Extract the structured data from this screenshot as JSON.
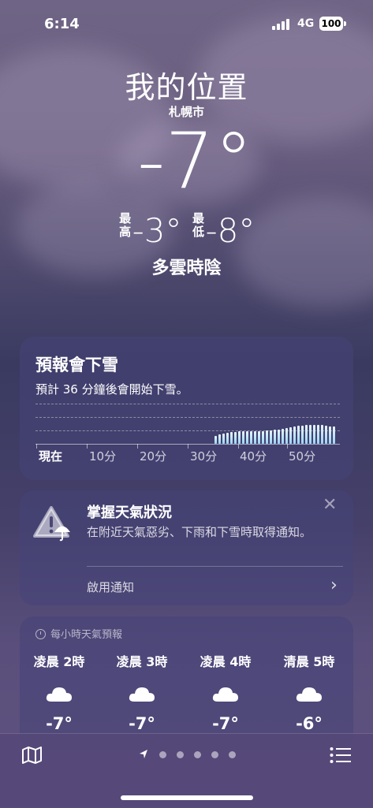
{
  "status_bar": {
    "time": "6:14",
    "network": "4G",
    "battery": "100"
  },
  "location": {
    "title": "我的位置",
    "city": "札幌市"
  },
  "current": {
    "temp": "-7°",
    "high_label": "最高",
    "high": "-3°",
    "low_label": "最低",
    "low": "-8°",
    "condition": "多雲時陰"
  },
  "precip_card": {
    "title": "預報會下雪",
    "desc": "預計 36 分鐘後會開始下雪。",
    "ticks": [
      "現在",
      "10分",
      "20分",
      "30分",
      "40分",
      "50分"
    ]
  },
  "alert_card": {
    "title": "掌握天氣狀況",
    "desc": "在附近天氣惡劣、下雨和下雪時取得通知。",
    "enable_label": "啟用通知"
  },
  "hourly_card": {
    "header": "每小時天氣預報",
    "hours": [
      {
        "time": "凌晨 2時",
        "icon": "cloud-icon",
        "temp": "-7°"
      },
      {
        "time": "凌晨 3時",
        "icon": "cloud-icon",
        "temp": "-7°"
      },
      {
        "time": "凌晨 4時",
        "icon": "cloud-icon",
        "temp": "-7°"
      },
      {
        "time": "清晨 5時",
        "icon": "cloud-icon",
        "temp": "-6°"
      }
    ]
  },
  "bottom_bar": {
    "map_icon": "map-icon",
    "list_icon": "list-icon",
    "page_count": 6,
    "current_page": 0
  },
  "colors": {
    "precip_bar": "#9cd4f3",
    "card_bg": "#46447a"
  }
}
